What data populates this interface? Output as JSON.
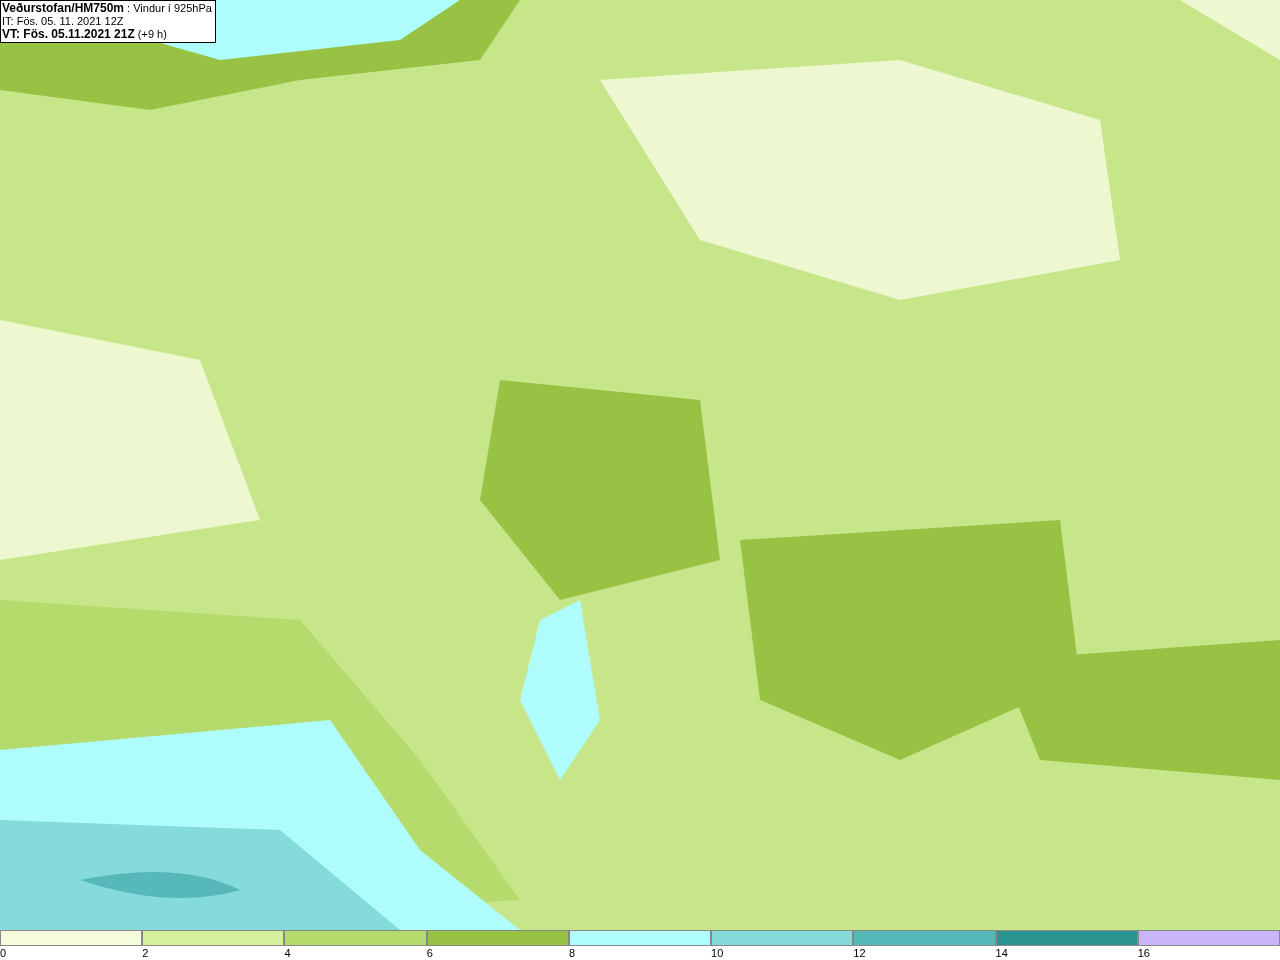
{
  "header": {
    "lines": [
      "**Veðurstofan/HM750m** : Vindur í 925hPa",
      "IT: Fös. 05. 11. 2021 12Z",
      "**VT: Fös. 05.11.2021 21Z** (+9 h)"
    ]
  },
  "legend": [
    {
      "label": "0",
      "color": "#f5fcdc"
    },
    {
      "label": "2",
      "color": "#d4f09a"
    },
    {
      "label": "4",
      "color": "#b5db6c"
    },
    {
      "label": "6",
      "color": "#98c244"
    },
    {
      "label": "8",
      "color": "#aefcfc"
    },
    {
      "label": "10",
      "color": "#85dbd9"
    },
    {
      "label": "12",
      "color": "#56b8b8"
    },
    {
      "label": "14",
      "color": "#2a9490"
    },
    {
      "label": "16",
      "color": "#c8b4f8"
    }
  ]
}
